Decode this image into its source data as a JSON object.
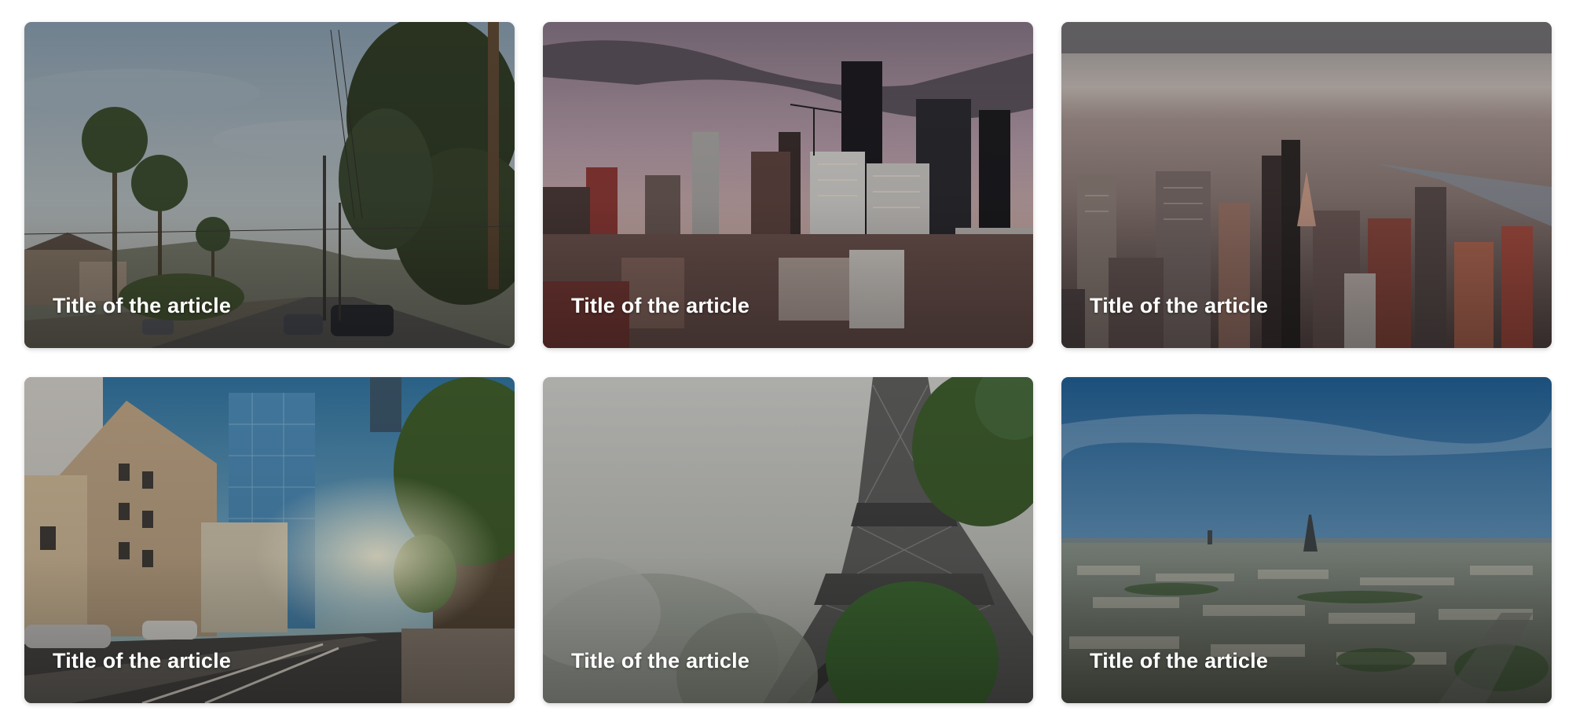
{
  "articles": [
    {
      "title": "Title of the article",
      "scene": "palm-street"
    },
    {
      "title": "Title of the article",
      "scene": "downtown-skyline-dusk"
    },
    {
      "title": "Title of the article",
      "scene": "aerial-city-river"
    },
    {
      "title": "Title of the article",
      "scene": "street-towers-sunlight"
    },
    {
      "title": "Title of the article",
      "scene": "eiffel-tower-trees"
    },
    {
      "title": "Title of the article",
      "scene": "paris-panorama"
    }
  ]
}
